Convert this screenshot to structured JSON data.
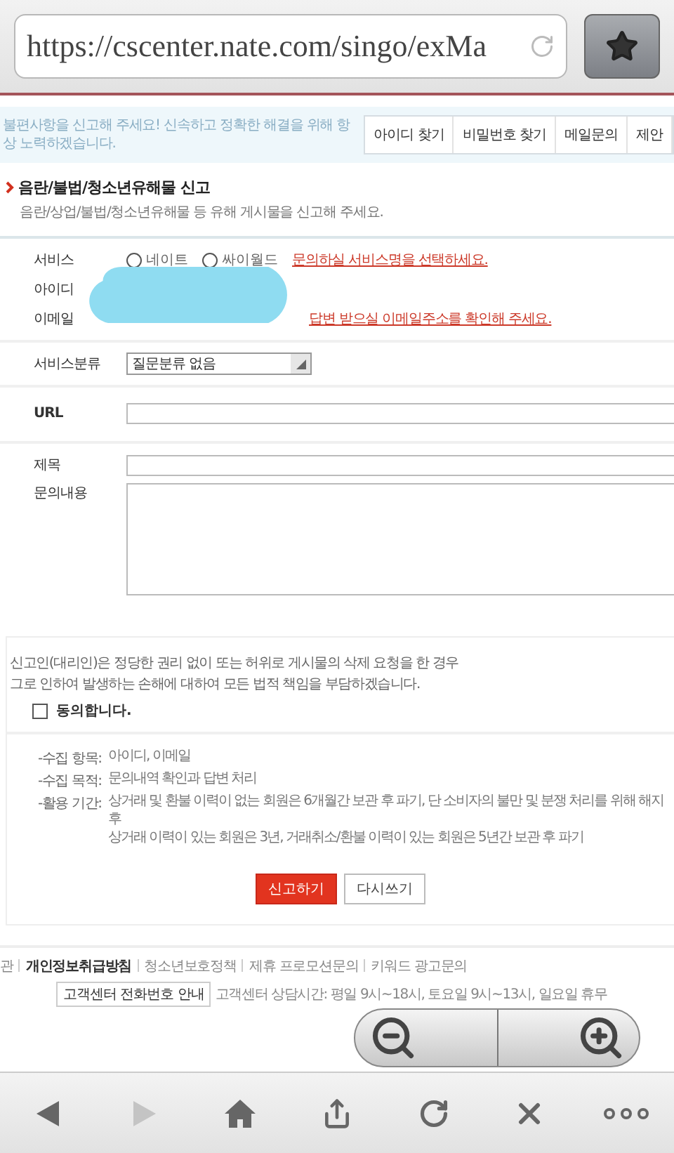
{
  "browser": {
    "url": "https://cscenter.nate.com/singo/exMa"
  },
  "notice": "불편사항을 신고해 주세요! 신속하고 정확한 해결을 위해 항상 노력하겠습니다.",
  "tabs": [
    "아이디 찾기",
    "비밀번호 찾기",
    "메일문의",
    "제안"
  ],
  "form": {
    "title": "음란/불법/청소년유해물 신고",
    "subtitle": "음란/상업/불법/청소년유해물 등 유해 게시물을 신고해 주세요.",
    "service": {
      "label": "서비스",
      "options": [
        {
          "label": "네이트",
          "selected": false
        },
        {
          "label": "싸이월드",
          "selected": false
        }
      ],
      "hint": "문의하실 서비스명을 선택하세요."
    },
    "id": {
      "label": "아이디"
    },
    "email": {
      "label": "이메일",
      "hint": "답변 받으실 이메일주소를 확인해 주세요."
    },
    "category": {
      "label": "서비스분류",
      "value": "질문분류 없음"
    },
    "url": {
      "label": "URL"
    },
    "subject": {
      "label": "제목"
    },
    "content": {
      "label": "문의내용"
    }
  },
  "agreement": {
    "text_lines": [
      "신고인(대리인)은 정당한 권리 없이 또는 허위로 게시물의 삭제 요청을 한 경우",
      "그로 인하여 발생하는 손해에 대하여 모든 법적 책임을 부담하겠습니다."
    ],
    "checkbox": {
      "label": "동의합니다.",
      "checked": false
    },
    "items": [
      {
        "term": "-수집 항목:",
        "lines": [
          "아이디, 이메일"
        ]
      },
      {
        "term": "-수집 목적:",
        "lines": [
          "문의내역 확인과 답변 처리"
        ]
      },
      {
        "term": "-활용 기간:",
        "lines": [
          "상거래 및 환불 이력이 없는 회원은 6개월간 보관 후 파기, 단 소비자의 불만 및 분쟁 처리를 위해 해지 후",
          "상거래 이력이 있는 회원은 3년, 거래취소/환불 이력이 있는 회원은 5년간 보관 후 파기"
        ]
      }
    ],
    "buttons": [
      {
        "label": "신고하기",
        "kind": "primary"
      },
      {
        "label": "다시쓰기",
        "kind": "secondary"
      }
    ]
  },
  "footer": {
    "links": [
      {
        "label": "관",
        "bold": false
      },
      {
        "label": "개인정보취급방침",
        "bold": true
      },
      {
        "label": "청소년보호정책",
        "bold": false
      },
      {
        "label": "제휴 프로모션문의",
        "bold": false
      },
      {
        "label": "키워드 광고문의",
        "bold": false
      }
    ],
    "phone_button": "고객센터 전화번호 안내",
    "hours": "고객센터 상담시간: 평일 9시~18시, 토요일 9시~13시, 일요일 휴무"
  },
  "toolbar": [
    {
      "kind": "back",
      "disabled": false
    },
    {
      "kind": "forward",
      "disabled": true
    },
    {
      "kind": "home",
      "disabled": false
    },
    {
      "kind": "share",
      "disabled": false
    },
    {
      "kind": "reload",
      "disabled": false
    },
    {
      "kind": "close",
      "disabled": false
    },
    {
      "kind": "more",
      "disabled": false
    }
  ]
}
